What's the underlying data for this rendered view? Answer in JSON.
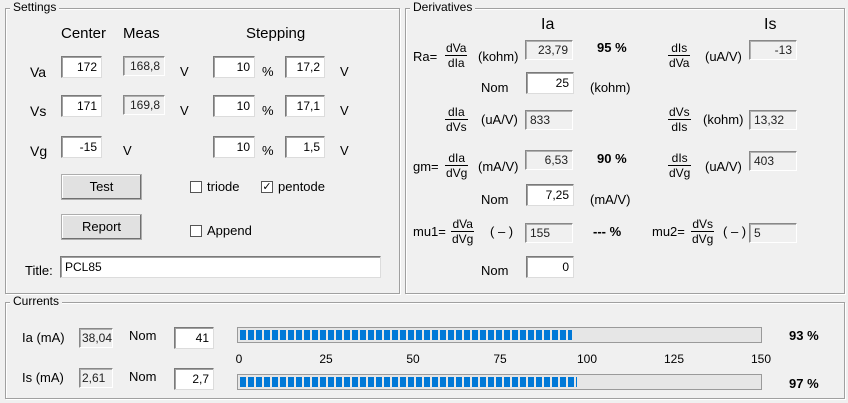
{
  "settings": {
    "title": "Settings",
    "col_center": "Center",
    "col_meas": "Meas",
    "col_stepping": "Stepping",
    "rows": [
      {
        "label": "Va",
        "center": "172",
        "meas": "168,8",
        "unit": "V",
        "step_pct": "10",
        "pct_sign": "%",
        "step_val": "17,2",
        "step_unit": "V"
      },
      {
        "label": "Vs",
        "center": "171",
        "meas": "169,8",
        "unit": "V",
        "step_pct": "10",
        "pct_sign": "%",
        "step_val": "17,1",
        "step_unit": "V"
      },
      {
        "label": "Vg",
        "center": "-15",
        "meas": "",
        "unit": "V",
        "step_pct": "10",
        "pct_sign": "%",
        "step_val": "1,5",
        "step_unit": "V"
      }
    ],
    "test_button": "Test",
    "report_button": "Report",
    "triode_label": "triode",
    "triode_checked": false,
    "pentode_label": "pentode",
    "pentode_checked": true,
    "append_label": "Append",
    "append_checked": false,
    "title_label": "Title:",
    "title_value": "PCL85"
  },
  "derivatives": {
    "title": "Derivatives",
    "head_ia": "Ia",
    "head_is": "Is",
    "ra_label": "Ra=",
    "ra_num": "dVa",
    "ra_den": "dIa",
    "ra_unit": "(kohm)",
    "ra_value": "23,79",
    "ra_pct": "95  %",
    "dis_dva_num": "dIs",
    "dis_dva_den": "dVa",
    "dis_dva_unit": "(uA/V)",
    "dis_dva_value": "-13",
    "nom_label_1": "Nom",
    "nom_ra": "25",
    "nom_ra_unit": "(kohm)",
    "dia_dvs_num": "dIa",
    "dia_dvs_den": "dVs",
    "dia_dvs_unit": "(uA/V)",
    "dia_dvs_value": "833",
    "dvs_dis_num": "dVs",
    "dvs_dis_den": "dIs",
    "dvs_dis_unit": "(kohm)",
    "dvs_dis_value": "13,32",
    "gm_label": "gm=",
    "gm_num": "dIa",
    "gm_den": "dVg",
    "gm_unit": "(mA/V)",
    "gm_value": "6,53",
    "gm_pct": "90  %",
    "dis_dvg_num": "dIs",
    "dis_dvg_den": "dVg",
    "dis_dvg_unit": "(uA/V)",
    "dis_dvg_value": "403",
    "nom_label_2": "Nom",
    "nom_gm": "7,25",
    "nom_gm_unit": "(mA/V)",
    "mu1_label": "mu1=",
    "mu1_num": "dVa",
    "mu1_den": "dVg",
    "mu1_unit": "( – )",
    "mu1_value": "155",
    "mu1_pct": "---  %",
    "mu2_label": "mu2=",
    "mu2_num": "dVs",
    "mu2_den": "dVg",
    "mu2_unit": "( – )",
    "mu2_value": "5",
    "nom_label_3": "Nom",
    "nom_mu": "0"
  },
  "currents": {
    "title": "Currents",
    "ia_label": "Ia (mA)",
    "ia_value": "38,04",
    "ia_nom_label": "Nom",
    "ia_nom": "41",
    "ia_bar_fraction": 0.64,
    "ia_pct": "93  %",
    "is_label": "Is (mA)",
    "is_value": "2,61",
    "is_nom_label": "Nom",
    "is_nom": "2,7",
    "is_bar_fraction": 0.65,
    "is_pct": "97  %",
    "scale_ticks": [
      "0",
      "25",
      "50",
      "75",
      "100",
      "125",
      "150"
    ]
  },
  "colors": {
    "bar": "#0078d7"
  }
}
